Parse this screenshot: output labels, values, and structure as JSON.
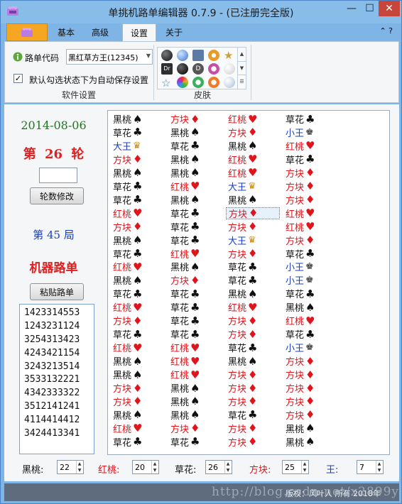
{
  "window": {
    "title": "单挑机路单编辑器 0.7.9 - (已注册完全版)",
    "controls": {
      "minimize": "—",
      "maximize": "☐",
      "close": "✕"
    }
  },
  "tabs": [
    {
      "label": "基本",
      "active": false
    },
    {
      "label": "高级",
      "active": false
    },
    {
      "label": "设置",
      "active": true
    },
    {
      "label": "关于",
      "active": false
    }
  ],
  "help_glyph": "⌃ ?",
  "settings": {
    "roadcode_label": "路单代码",
    "roadcode_value": "黑红草方王(12345)",
    "autosave_label": "默认勾选状态下为自动保存设置",
    "autosave_checked": true,
    "group_label": "软件设置"
  },
  "skins": {
    "group_label": "皮肤",
    "items": [
      "dark-sphere",
      "blue-sphere",
      "square",
      "orange-orb",
      "star",
      "dr-badge",
      "black-orb",
      "d-badge",
      "pink-orb",
      "white-orb",
      "blue-star",
      "rainbow",
      "green-orb",
      "orange-round",
      "pale-orb"
    ],
    "colors": [
      "#3a3a3a",
      "#5b8fd6",
      "#6b7f99",
      "#e7a43a",
      "#d9b54a",
      "#2f2f2f",
      "#222222",
      "#5a5a5a",
      "#d56fb3",
      "#f0f0f0",
      "#2a8ad4",
      "#8a5fd6",
      "#3aaf5f",
      "#ef7a2a",
      "#cfd8e2"
    ]
  },
  "left": {
    "date": "2014-08-06",
    "round_prefix": "第",
    "round_number": "26",
    "round_suffix": "轮",
    "round_input": "",
    "modify_button": "轮数修改",
    "game_text": "第 45 局",
    "robot_title": "机器路单",
    "paste_button": "粘贴路单",
    "codes": [
      "1423314553",
      "1243231124",
      "3254313423",
      "4243421154",
      "3243213514",
      "3533132221",
      "4342333322",
      "3512141241",
      "4114414412",
      "3424413341"
    ]
  },
  "suit_colors": {
    "黑桃": "#111111",
    "红桃": "#e0141b",
    "草花": "#111111",
    "方块": "#e0141b",
    "大王": "#1a3fc0",
    "小王": "#1a3fc0"
  },
  "suit_text_colors": {
    "黑桃": "#111111",
    "红桃": "#e0141b",
    "草花": "#111111",
    "方块": "#e0141b",
    "大王": "#1a3fc0",
    "小王": "#1a3fc0"
  },
  "suit_symbols": {
    "黑桃": "♠",
    "红桃": "♥",
    "草花": "♣",
    "方块": "♦",
    "大王": "♛",
    "小王": "♚"
  },
  "grid": {
    "columns": [
      [
        "黑桃",
        "草花",
        "大王",
        "方块",
        "黑桃",
        "草花",
        "草花",
        "红桃",
        "方块",
        "黑桃",
        "草花",
        "红桃",
        "黑桃",
        "草花",
        "红桃",
        "方块",
        "草花",
        "红桃",
        "黑桃",
        "黑桃",
        "方块",
        "方块",
        "黑桃",
        "红桃",
        "草花"
      ],
      [
        "方块",
        "黑桃",
        "草花",
        "黑桃",
        "黑桃",
        "红桃",
        "黑桃",
        "草花",
        "草花",
        "草花",
        "红桃",
        "黑桃",
        "方块",
        "草花",
        "草花",
        "草花",
        "草花",
        "红桃",
        "红桃",
        "红桃",
        "黑桃",
        "黑桃",
        "黑桃",
        "方块",
        "草花"
      ],
      [
        "红桃",
        "方块",
        "黑桃",
        "红桃",
        "红桃",
        "大王",
        "黑桃",
        "方块",
        "方块",
        "大王",
        "方块",
        "草花",
        "草花",
        "黑桃",
        "红桃",
        "方块",
        "方块",
        "草花",
        "黑桃",
        "方块",
        "方块",
        "方块",
        "草花",
        "方块",
        "方块"
      ],
      [
        "草花",
        "小王",
        "红桃",
        "草花",
        "方块",
        "方块",
        "方块",
        "红桃",
        "红桃",
        "方块",
        "草花",
        "小王",
        "小王",
        "草花",
        "黑桃",
        "红桃",
        "草花",
        "小王",
        "方块",
        "方块",
        "方块",
        "方块",
        "方块",
        "黑桃",
        "黑桃"
      ]
    ],
    "selected_cell": {
      "col": 2,
      "row": 7
    }
  },
  "counts": {
    "spade_label": "黑桃:",
    "spade_value": "22",
    "heart_label": "红桃:",
    "heart_value": "20",
    "club_label": "草花:",
    "club_value": "26",
    "diamond_label": "方块:",
    "diamond_value": "25",
    "king_label": "王:",
    "king_value": "7"
  },
  "status": {
    "watermark": "http://blog.csdn.net/x2899y",
    "copyright": "版权：风叶人 所有 2018年"
  }
}
